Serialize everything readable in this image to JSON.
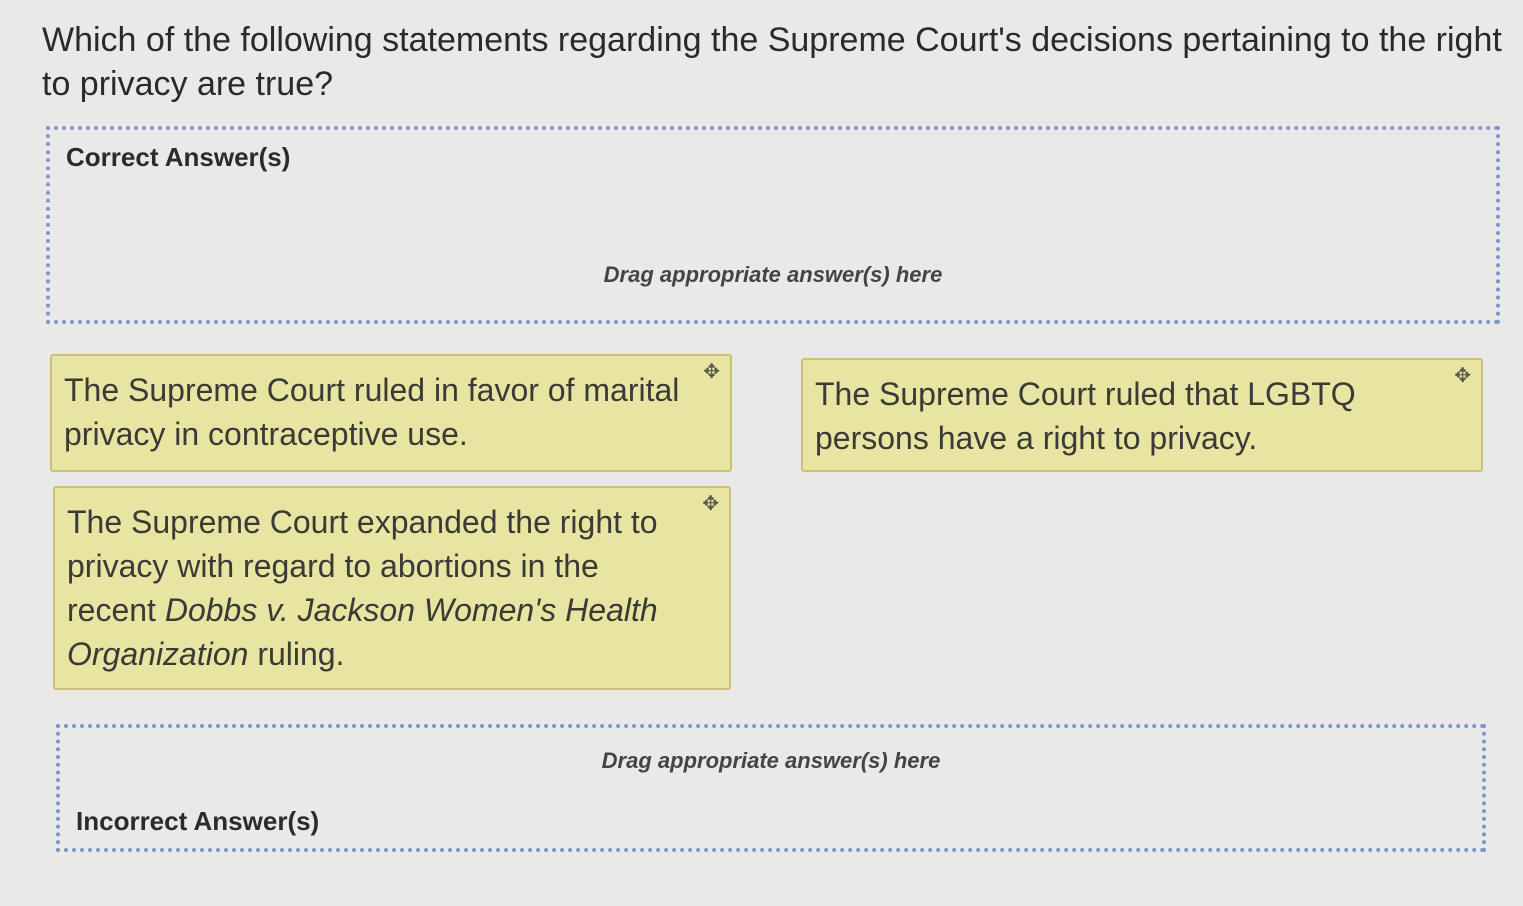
{
  "question": {
    "text": "Which of the following statements regarding the Supreme Court's decisions pertaining to the right to privacy are true?"
  },
  "zones": {
    "correct": {
      "label": "Correct Answer(s)",
      "hint": "Drag appropriate answer(s) here"
    },
    "incorrect": {
      "label": "Incorrect Answer(s)",
      "hint": "Drag appropriate answer(s) here"
    }
  },
  "cards": [
    {
      "text": "The Supreme Court ruled in favor of marital privacy in contraceptive use.",
      "icon": "move-icon"
    },
    {
      "text": "The Supreme Court ruled that LGBTQ persons have a right to privacy.",
      "icon": "move-icon"
    },
    {
      "text_before": "The Supreme Court expanded the right to privacy with regard to abortions in the recent ",
      "text_italic": "Dobbs v. Jackson Women's Health Organization",
      "text_after": " ruling.",
      "icon": "move-icon"
    }
  ],
  "colors": {
    "card_bg": "#e8e4a2",
    "card_border": "#cdbf72",
    "zone_border": "#7f95c9",
    "page_bg": "#e9eae8"
  }
}
